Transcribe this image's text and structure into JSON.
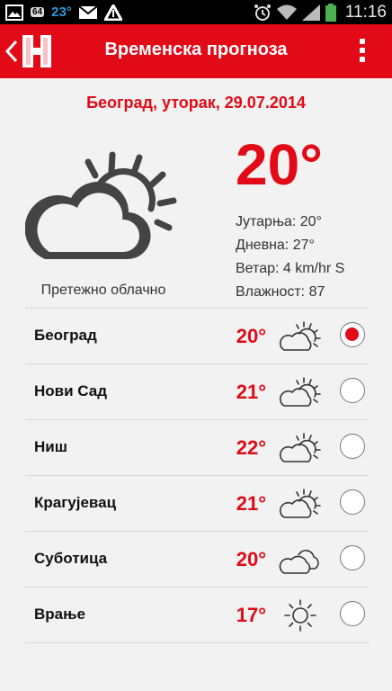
{
  "status_bar": {
    "temperature": "23°",
    "badge": "64",
    "time": "11:16"
  },
  "app_bar": {
    "title": "Временска прогноза",
    "logo_letter": "H",
    "accent_color": "#e20a16"
  },
  "current": {
    "date_line": "Београд, уторак, 29.07.2014",
    "temperature": "20°",
    "condition": "Претежно облачно",
    "icon": "partly-cloudy-icon",
    "details": [
      "Јутарња: 20°",
      "Дневна: 27°",
      "Ветар: 4 km/hr S",
      "Влажност: 87"
    ]
  },
  "cities": [
    {
      "name": "Београд",
      "temp": "20°",
      "icon": "partly-cloudy-icon",
      "selected": true
    },
    {
      "name": "Нови Сад",
      "temp": "21°",
      "icon": "partly-cloudy-icon",
      "selected": false
    },
    {
      "name": "Ниш",
      "temp": "22°",
      "icon": "partly-cloudy-icon",
      "selected": false
    },
    {
      "name": "Крагујевац",
      "temp": "21°",
      "icon": "partly-cloudy-icon",
      "selected": false
    },
    {
      "name": "Суботица",
      "temp": "20°",
      "icon": "cloudy-icon",
      "selected": false
    },
    {
      "name": "Врање",
      "temp": "17°",
      "icon": "sunny-icon",
      "selected": false
    }
  ]
}
